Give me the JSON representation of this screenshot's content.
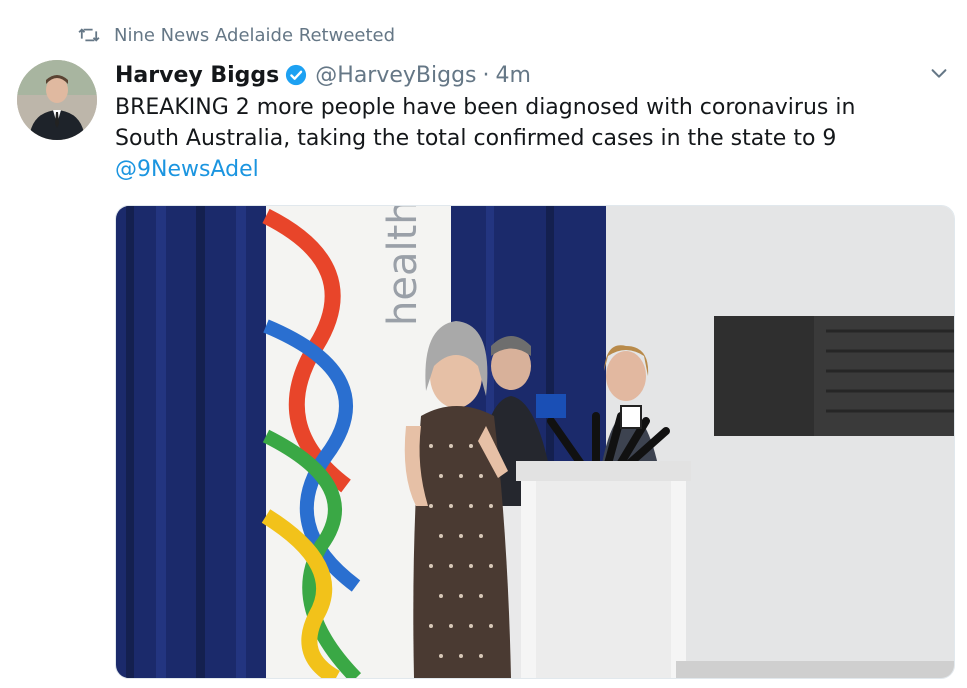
{
  "retweet": {
    "label": "Nine News Adelaide Retweeted",
    "icon": "retweet-icon"
  },
  "tweet": {
    "author_name": "Harvey Biggs",
    "handle": "@HarveyBiggs",
    "separator": "·",
    "time": "4m",
    "text_line1": "BREAKING 2 more people have been diagnosed with coronavirus in",
    "text_line2": "South Australia, taking the total confirmed cases in the state to 9",
    "mention": "@9NewsAdel",
    "verified_icon": "verified-badge-icon",
    "menu_icon": "chevron-down-icon"
  },
  "media": {
    "banner_text": "health",
    "accent_colors": {
      "blue_curtain": "#1b2a6b",
      "link": "#1b95e0",
      "verified": "#1da1f2"
    }
  }
}
